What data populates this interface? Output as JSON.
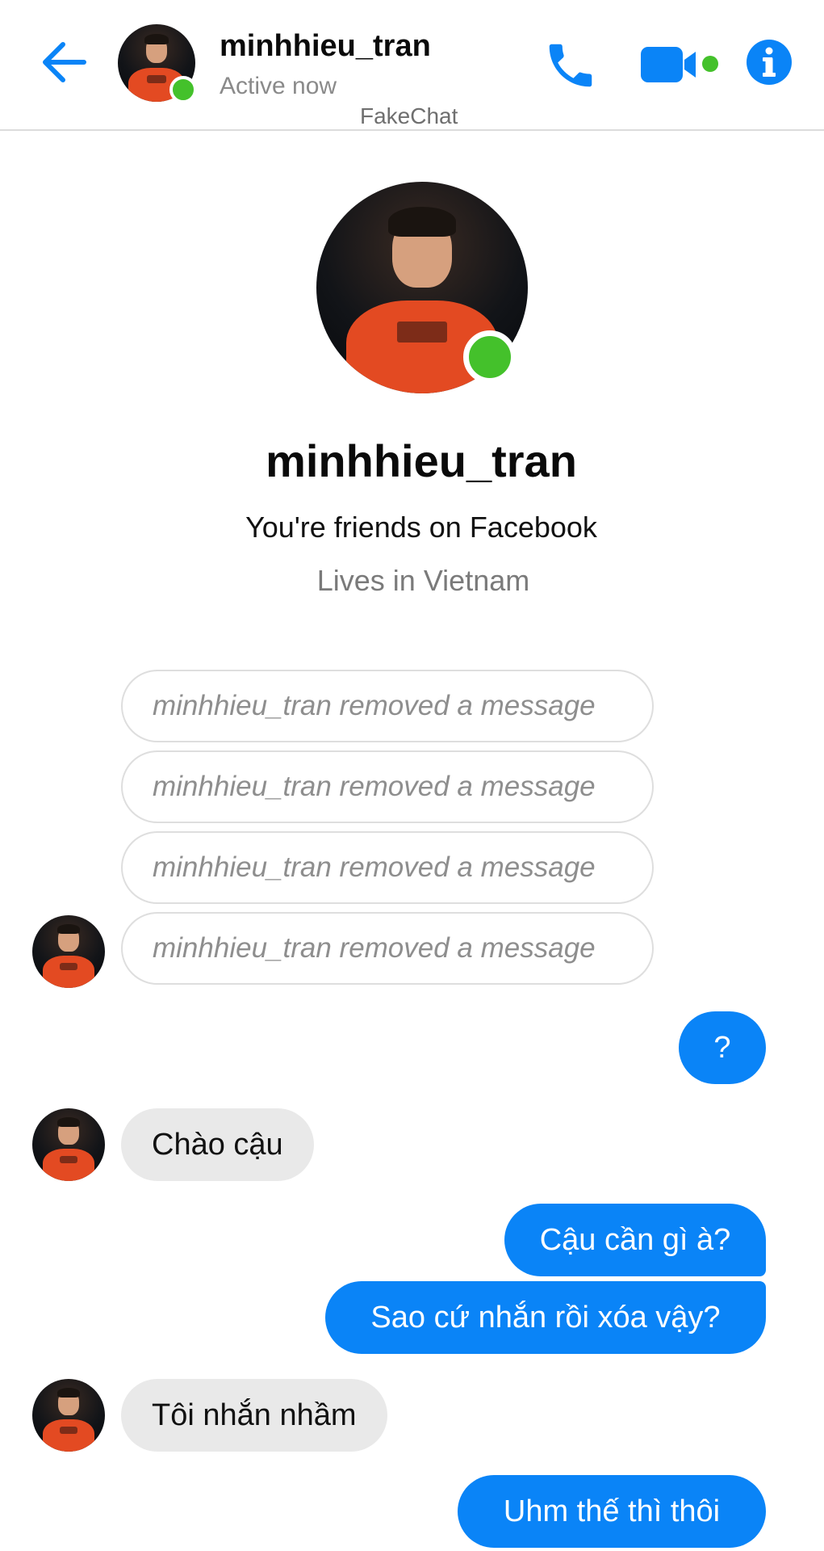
{
  "header": {
    "contact_name": "minhhieu_tran",
    "status": "Active now",
    "app_name": "FakeChat",
    "icons": [
      "back-arrow-icon",
      "phone-icon",
      "video-camera-icon",
      "info-icon"
    ],
    "accent_color": "#0a84f7",
    "online_color": "#44c12b"
  },
  "profile": {
    "name": "minhhieu_tran",
    "friendship": "You're friends on Facebook",
    "location": "Lives in Vietnam"
  },
  "messages": {
    "removed": [
      "minhhieu_tran removed a message",
      "minhhieu_tran removed a message",
      "minhhieu_tran removed a message",
      "minhhieu_tran removed a message"
    ],
    "out_1": "?",
    "in_1": "Chào cậu",
    "out_2": "Cậu cần gì à?",
    "out_3": "Sao cứ nhắn rồi xóa vậy?",
    "in_2": "Tôi nhắn nhầm",
    "out_4": "Uhm thế thì thôi"
  }
}
